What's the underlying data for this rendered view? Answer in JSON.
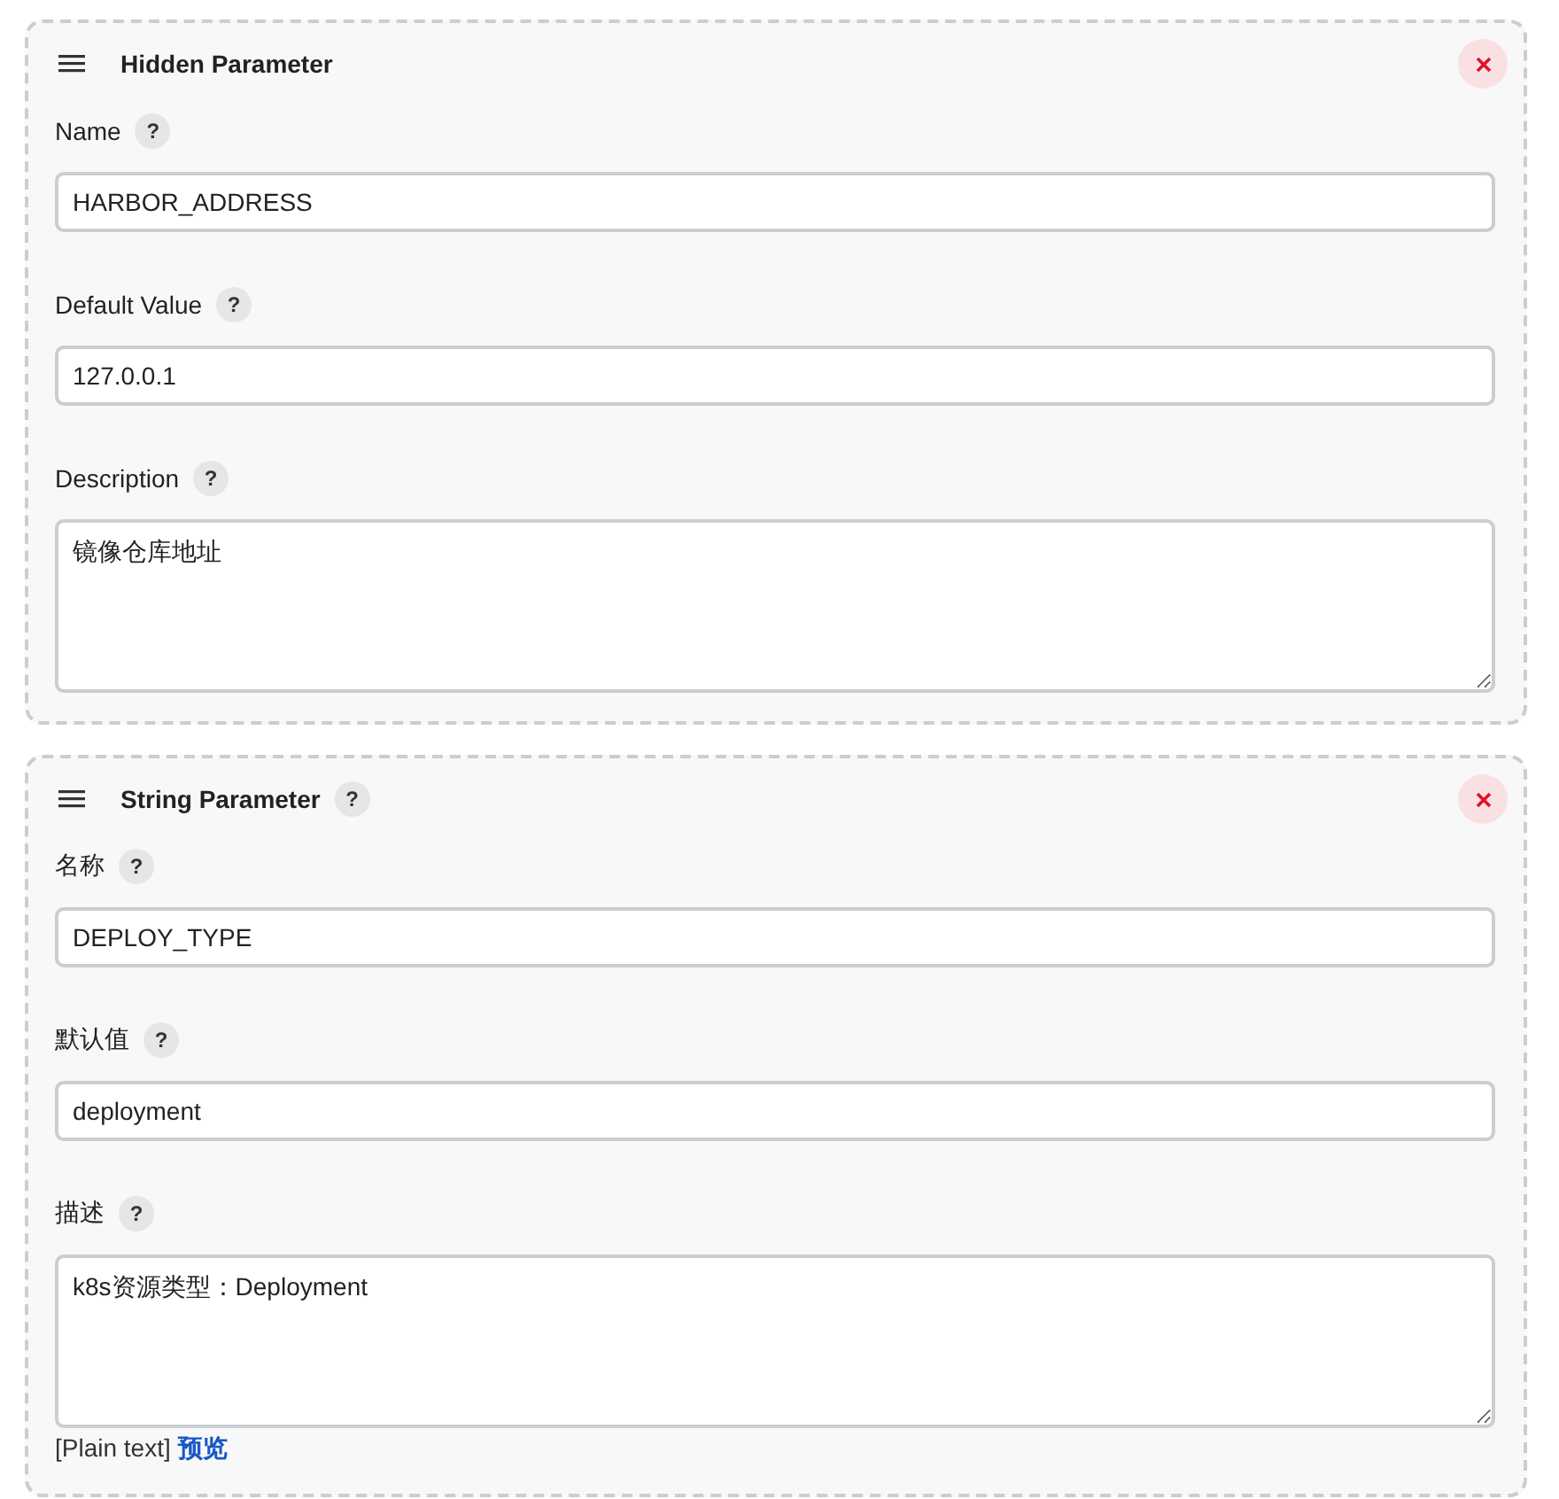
{
  "parameters": [
    {
      "title": "Hidden Parameter",
      "fields": [
        {
          "kind": "input",
          "label": "Name",
          "help": "?",
          "value": "HARBOR_ADDRESS"
        },
        {
          "kind": "input",
          "label": "Default Value",
          "help": "?",
          "value": "127.0.0.1"
        },
        {
          "kind": "textarea",
          "label": "Description",
          "help": "?",
          "value": "镜像仓库地址"
        }
      ]
    },
    {
      "title": "String Parameter",
      "title_help": "?",
      "fields": [
        {
          "kind": "input",
          "label": "名称",
          "help": "?",
          "value": "DEPLOY_TYPE"
        },
        {
          "kind": "input",
          "label": "默认值",
          "help": "?",
          "value": "deployment"
        },
        {
          "kind": "textarea",
          "label": "描述",
          "help": "?",
          "value": "k8s资源类型：Deployment"
        }
      ],
      "footer": {
        "format": "[Plain text]",
        "preview_link": "预览"
      }
    }
  ]
}
